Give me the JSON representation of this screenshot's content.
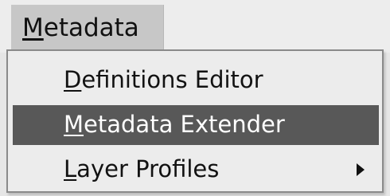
{
  "menubar": {
    "menu_title_mnemonic": "M",
    "menu_title_rest": "etadata"
  },
  "dropdown": {
    "items": [
      {
        "mnemonic": "D",
        "rest": "efinitions Editor",
        "active": false,
        "submenu": false
      },
      {
        "mnemonic": "M",
        "rest": "etadata Extender",
        "active": true,
        "submenu": false
      },
      {
        "mnemonic": "L",
        "rest": "ayer Profiles",
        "active": false,
        "submenu": true,
        "submenu_icon": "triangle-right-icon"
      }
    ]
  },
  "colors": {
    "menubar_bg": "#ededed",
    "menu_title_bg": "#c7c7c7",
    "dropdown_bg": "#ececec",
    "highlight_bg": "#585858",
    "highlight_text": "#ffffff",
    "text": "#121212"
  }
}
